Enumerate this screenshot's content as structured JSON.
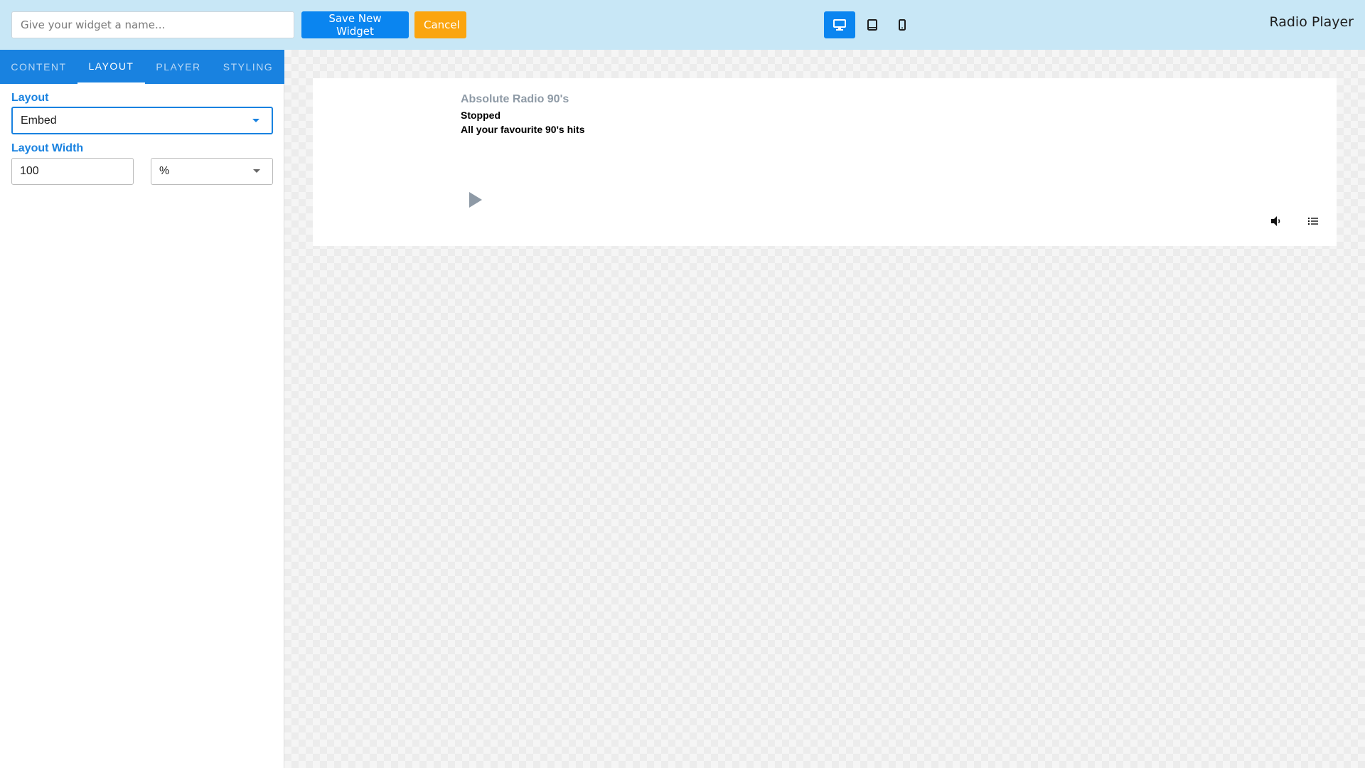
{
  "header": {
    "name_placeholder": "Give your widget a name...",
    "save_label": "Save New Widget",
    "cancel_label": "Cancel",
    "devices": [
      {
        "icon": "desktop-icon",
        "active": true
      },
      {
        "icon": "tablet-icon",
        "active": false
      },
      {
        "icon": "mobile-icon",
        "active": false
      }
    ],
    "app_title": "Radio Player"
  },
  "sidebar": {
    "tabs": [
      {
        "label": "CONTENT",
        "active": false
      },
      {
        "label": "LAYOUT",
        "active": true
      },
      {
        "label": "PLAYER",
        "active": false
      },
      {
        "label": "STYLING",
        "active": false
      }
    ],
    "layout_label": "Layout",
    "layout_value": "Embed",
    "width_label": "Layout Width",
    "width_value": "100",
    "width_unit": "%"
  },
  "player": {
    "station_name": "Absolute Radio 90's",
    "status": "Stopped",
    "description": "All your favourite 90's hits",
    "icons": [
      "play-icon",
      "volume-icon",
      "playlist-icon"
    ]
  },
  "colors": {
    "topbar_bg": "#c8e7f6",
    "primary": "#0a85f0",
    "tabs_bg": "#1982e0",
    "cancel": "#fba50f"
  }
}
